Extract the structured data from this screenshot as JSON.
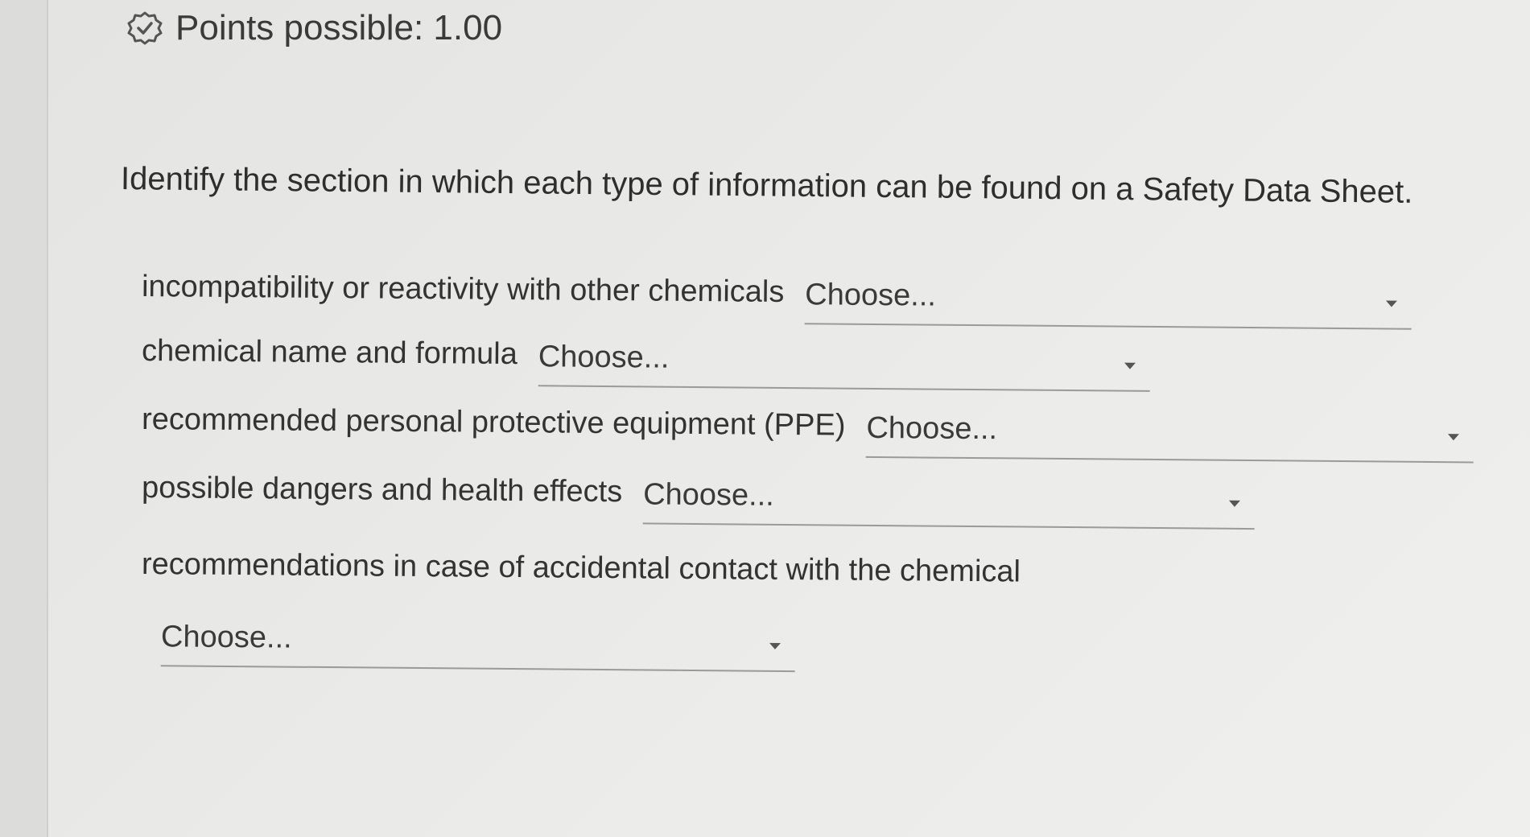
{
  "header": {
    "points_label": "Points possible: 1.00"
  },
  "question": {
    "prompt": "Identify the section in which each type of information can be found on a Safety Data Sheet."
  },
  "items": [
    {
      "label": "incompatibility or reactivity with other chemicals",
      "selected": "Choose..."
    },
    {
      "label": "chemical name and formula",
      "selected": "Choose..."
    },
    {
      "label": "recommended personal protective equipment (PPE)",
      "selected": "Choose..."
    },
    {
      "label": "possible dangers and health effects",
      "selected": "Choose..."
    },
    {
      "label": "recommendations in case of accidental contact with the chemical",
      "selected": "Choose..."
    }
  ]
}
